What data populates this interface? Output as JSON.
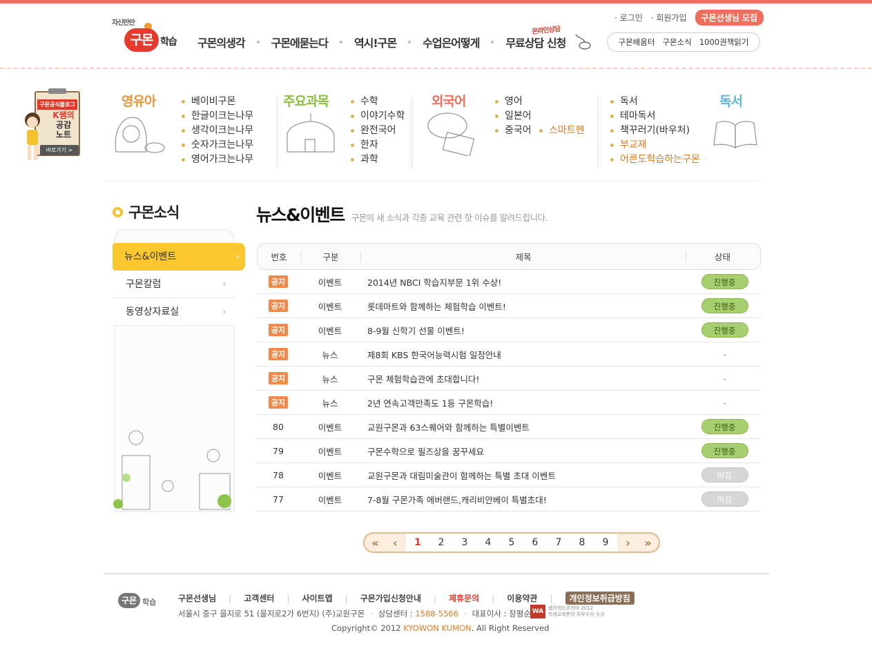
{
  "header": {
    "logo_small": "자신만만",
    "logo_badge": "구몬",
    "logo_name": "학습",
    "gnb": [
      "구몬의생각",
      "구몬에묻는다",
      "역시!구몬",
      "수업은어떻게",
      "무료상담 신청"
    ],
    "consult_tag": "온라인상담",
    "util": {
      "login": "· 로그인",
      "join": "· 회원가입",
      "recruit": "구몬선생님 모집"
    },
    "quick": [
      "구몬배움터",
      "구몬소식",
      "1000권책읽기"
    ]
  },
  "blog": {
    "label": "구몬공식블로그",
    "title_line1": "K쌤의",
    "title_line2": "공감",
    "title_line3": "노트",
    "go": "바로가기 >"
  },
  "categories": [
    {
      "title": "영유아",
      "color": "#e9963d",
      "items": [
        "베이비구몬",
        "한글이크는나무",
        "생각이크는나무",
        "숫자가크는나무",
        "영어가크는나무"
      ]
    },
    {
      "title": "주요과목",
      "color": "#8bbf3d",
      "items": [
        "수학",
        "이야기수학",
        "완전국어",
        "한자",
        "과학"
      ]
    },
    {
      "title": "외국어",
      "color": "#ee6f5b",
      "items": [
        "영어",
        "일본어",
        "중국어"
      ],
      "extra": "스마트펜"
    },
    {
      "title": "독서",
      "color": "#5fb6d6",
      "items": [
        "독서",
        "테마독서",
        "책꾸러기(바우처)"
      ],
      "orange_items": [
        "부교재",
        "어른도학습하는구몬"
      ]
    }
  ],
  "lnb": {
    "title": "구몬소식",
    "menu": [
      "뉴스&이벤트",
      "구몬칼럼",
      "동영상자료실"
    ],
    "active": 0
  },
  "main": {
    "title": "뉴스&이벤트",
    "desc": "구몬의 새 소식과 각종 교육 관련 핫 이슈를 알려드립니다.",
    "columns": [
      "번호",
      "구분",
      "제목",
      "상태"
    ],
    "rows": [
      {
        "no": "공지",
        "notice": true,
        "type": "이벤트",
        "title": "2014년 NBCI 학습지부문 1위 수상!",
        "state": "진행중",
        "on": true
      },
      {
        "no": "공지",
        "notice": true,
        "type": "이벤트",
        "title": "롯데마트와 함께하는 체험학습 이벤트!",
        "state": "진행중",
        "on": true
      },
      {
        "no": "공지",
        "notice": true,
        "type": "이벤트",
        "title": "8-9월 신학기 선물 이벤트!",
        "state": "진행중",
        "on": true
      },
      {
        "no": "공지",
        "notice": true,
        "type": "뉴스",
        "title": "제8회 KBS 한국어능력시험 일정안내",
        "state": "-",
        "on": null
      },
      {
        "no": "공지",
        "notice": true,
        "type": "뉴스",
        "title": "구몬 체험학습관에 초대합니다!",
        "state": "-",
        "on": null
      },
      {
        "no": "공지",
        "notice": true,
        "type": "뉴스",
        "title": "2년 연속고객만족도 1등 구몬학습!",
        "state": "-",
        "on": null
      },
      {
        "no": "80",
        "notice": false,
        "type": "이벤트",
        "title": "교원구몬과 63스퀘어와 함께하는 특별이벤트",
        "state": "진행중",
        "on": true
      },
      {
        "no": "79",
        "notice": false,
        "type": "이벤트",
        "title": "구몬수학으로 필즈상을 꿈꾸세요",
        "state": "진행중",
        "on": true
      },
      {
        "no": "78",
        "notice": false,
        "type": "이벤트",
        "title": "교원구몬과 대림미술관이 함께하는 특별 초대 이벤트",
        "state": "마감",
        "on": false
      },
      {
        "no": "77",
        "notice": false,
        "type": "이벤트",
        "title": "7-8월 구몬가족 에버랜드,캐리비안베이 특별초대!",
        "state": "마감",
        "on": false
      }
    ]
  },
  "pager": {
    "first": "«",
    "prev": "‹",
    "next": "›",
    "last": "»",
    "pages": [
      "1",
      "2",
      "3",
      "4",
      "5",
      "6",
      "7",
      "8",
      "9"
    ],
    "current": "1"
  },
  "footer": {
    "logo_badge": "구몬",
    "logo_name": "학습",
    "links": [
      "구몬선생님",
      "고객센터",
      "사이트맵",
      "구몬가입신청안내",
      "제휴문의",
      "이용약관",
      "개인정보취급방침"
    ],
    "address": "서울시 중구 을지로 51 (을지로2가 6번지) (주)교원구몬",
    "center_label": "상담센터 :",
    "center_phone": "1588-5566",
    "ceo": "대표이사 : 장평순",
    "award_line1": "웹어워드코리아 2012",
    "award_line2": "학생교육분야 최우수상 수상",
    "copyright_pre": "Copyright© 2012 ",
    "copyright_brand": "KYOWON KUMON",
    "copyright_post": ". All Right Reserved"
  },
  "colors": {
    "accent": "#ee6f5b",
    "lnb_active": "#fbc72f",
    "state_on": "#a8cf6f",
    "state_off": "#d6d6d6",
    "notice": "#f0894a"
  }
}
